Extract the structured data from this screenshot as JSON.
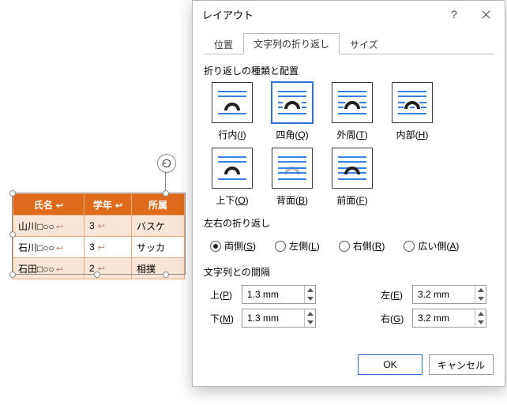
{
  "table": {
    "headers": [
      "氏名",
      "学年",
      "所属"
    ],
    "rows": [
      {
        "name": "山川□○○",
        "grade": "3",
        "club": "バスケ"
      },
      {
        "name": "石川□○○",
        "grade": "3",
        "club": "サッカ"
      },
      {
        "name": "石田□○○",
        "grade": "2",
        "club": "相撲"
      }
    ]
  },
  "dialog": {
    "title": "レイアウト",
    "tabs": {
      "pos": "位置",
      "wrap": "文字列の折り返し",
      "size": "サイズ"
    },
    "section_wrap": "折り返しの種類と配置",
    "wrap_options": [
      {
        "key": "inline",
        "label_pre": "行内(",
        "u": "I",
        "label_post": ")"
      },
      {
        "key": "square",
        "label_pre": "四角(",
        "u": "Q",
        "label_post": ")"
      },
      {
        "key": "tight",
        "label_pre": "外周(",
        "u": "T",
        "label_post": ")"
      },
      {
        "key": "through",
        "label_pre": "内部(",
        "u": "H",
        "label_post": ")"
      },
      {
        "key": "topbot",
        "label_pre": "上下(",
        "u": "O",
        "label_post": ")"
      },
      {
        "key": "behind",
        "label_pre": "背面(",
        "u": "B",
        "label_post": ")"
      },
      {
        "key": "front",
        "label_pre": "前面(",
        "u": "F",
        "label_post": ")"
      }
    ],
    "selected_wrap": "square",
    "section_lr": "左右の折り返し",
    "lr": {
      "both": {
        "pre": "両側(",
        "u": "S",
        "post": ")"
      },
      "left": {
        "pre": "左側(",
        "u": "L",
        "post": ")"
      },
      "right": {
        "pre": "右側(",
        "u": "R",
        "post": ")"
      },
      "wide": {
        "pre": "広い側(",
        "u": "A",
        "post": ")"
      }
    },
    "section_spacing": "文字列との間隔",
    "spacing": {
      "top": {
        "pre": "上(",
        "u": "P",
        "post": ")",
        "value": "1.3 mm"
      },
      "bottom": {
        "pre": "下(",
        "u": "M",
        "post": ")",
        "value": "1.3 mm"
      },
      "leftm": {
        "pre": "左(",
        "u": "E",
        "post": ")",
        "value": "3.2 mm"
      },
      "rightm": {
        "pre": "右(",
        "u": "G",
        "post": ")",
        "value": "3.2 mm"
      }
    },
    "buttons": {
      "ok": "OK",
      "cancel": "キャンセル"
    },
    "help": "?"
  }
}
